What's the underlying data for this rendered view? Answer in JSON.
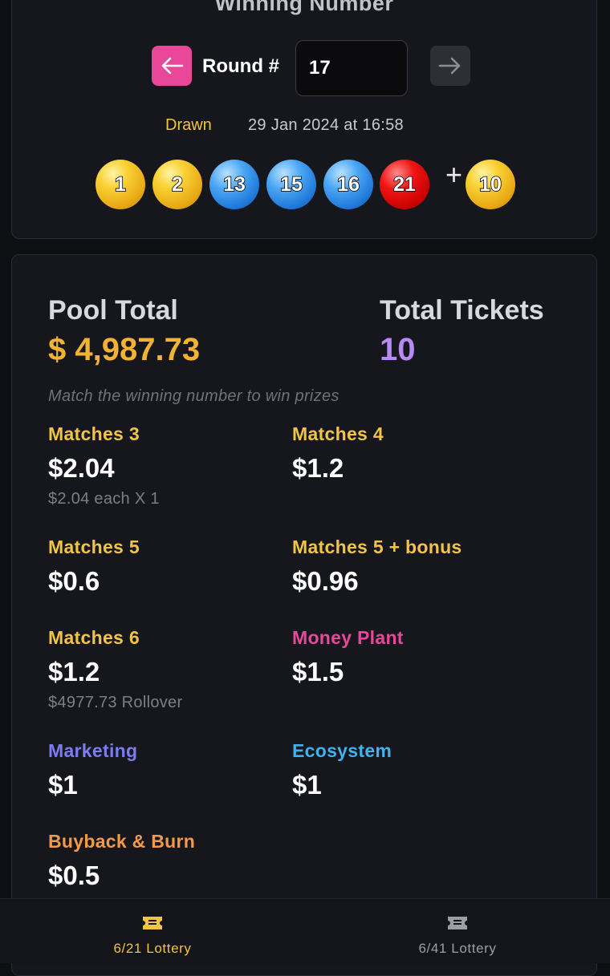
{
  "header": {
    "title": "Winning Number",
    "round_label": "Round #",
    "round_value": "17",
    "drawn_label": "Drawn",
    "drawn_date": "29 Jan 2024 at 16:58"
  },
  "balls": [
    {
      "number": "1",
      "color": "yellow"
    },
    {
      "number": "2",
      "color": "yellow"
    },
    {
      "number": "13",
      "color": "blue"
    },
    {
      "number": "15",
      "color": "blue"
    },
    {
      "number": "16",
      "color": "blue"
    },
    {
      "number": "21",
      "color": "red"
    }
  ],
  "plus": "+",
  "bonus_ball": {
    "number": "10",
    "color": "yellow"
  },
  "pool": {
    "title": "Pool Total",
    "value": "$ 4,987.73",
    "tickets_title": "Total Tickets",
    "tickets_value": "10",
    "hint": "Match the winning number to win prizes"
  },
  "prizes": [
    {
      "label": "Matches 3",
      "value": "$2.04",
      "sub": "$2.04 each X 1",
      "color": "#f2c443"
    },
    {
      "label": "Matches 4",
      "value": "$1.2",
      "sub": "",
      "color": "#f2c443"
    },
    {
      "label": "Matches 5",
      "value": "$0.6",
      "sub": "",
      "color": "#f2c443"
    },
    {
      "label": "Matches 5 + bonus",
      "value": "$0.96",
      "sub": "",
      "color": "#f2c443"
    },
    {
      "label": "Matches 6",
      "value": "$1.2",
      "sub": "$4977.73 Rollover",
      "color": "#f2c443"
    },
    {
      "label": "Money Plant",
      "value": "$1.5",
      "sub": "",
      "color": "#e8479a"
    },
    {
      "label": "Marketing",
      "value": "$1",
      "sub": "",
      "color": "#7b7df0"
    },
    {
      "label": "Ecosystem",
      "value": "$1",
      "sub": "",
      "color": "#3fb2ef"
    },
    {
      "label": "Buyback & Burn",
      "value": "$0.5",
      "sub": "",
      "color": "#f39a4a"
    }
  ],
  "bottom_nav": [
    {
      "label": "6/21 Lottery",
      "active": true,
      "color": "#f2c443"
    },
    {
      "label": "6/41 Lottery",
      "active": false,
      "color": "#9c9ea6"
    }
  ],
  "colors": {
    "accent_pink": "#e8479a",
    "gold": "#f2b233",
    "purple": "#b98af5",
    "background": "#0e0f12",
    "card": "#16171c"
  }
}
